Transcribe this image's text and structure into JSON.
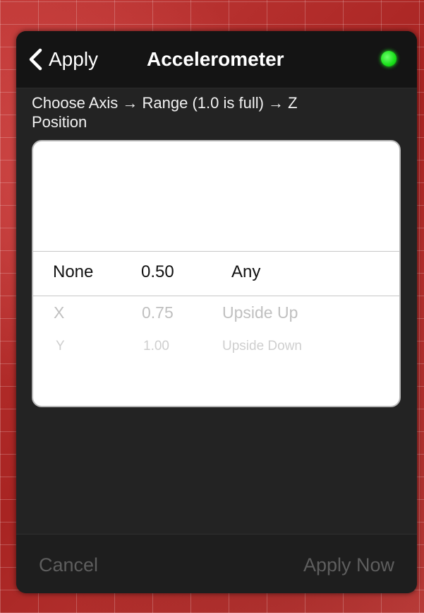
{
  "navbar": {
    "back_label": "Apply",
    "title": "Accelerometer",
    "status_color": "#22dd22"
  },
  "instruction": "Choose Axis → Range (1.0 is full) → Z Position",
  "picker": {
    "columns": [
      "axis",
      "range",
      "z_position"
    ],
    "selected": {
      "axis": "None",
      "range": "0.50",
      "z_position": "Any"
    },
    "rows_below": [
      {
        "axis": "X",
        "range": "0.75",
        "z_position": "Upside Up"
      },
      {
        "axis": "Y",
        "range": "1.00",
        "z_position": "Upside Down"
      }
    ]
  },
  "footer": {
    "cancel_label": "Cancel",
    "apply_label": "Apply Now"
  }
}
